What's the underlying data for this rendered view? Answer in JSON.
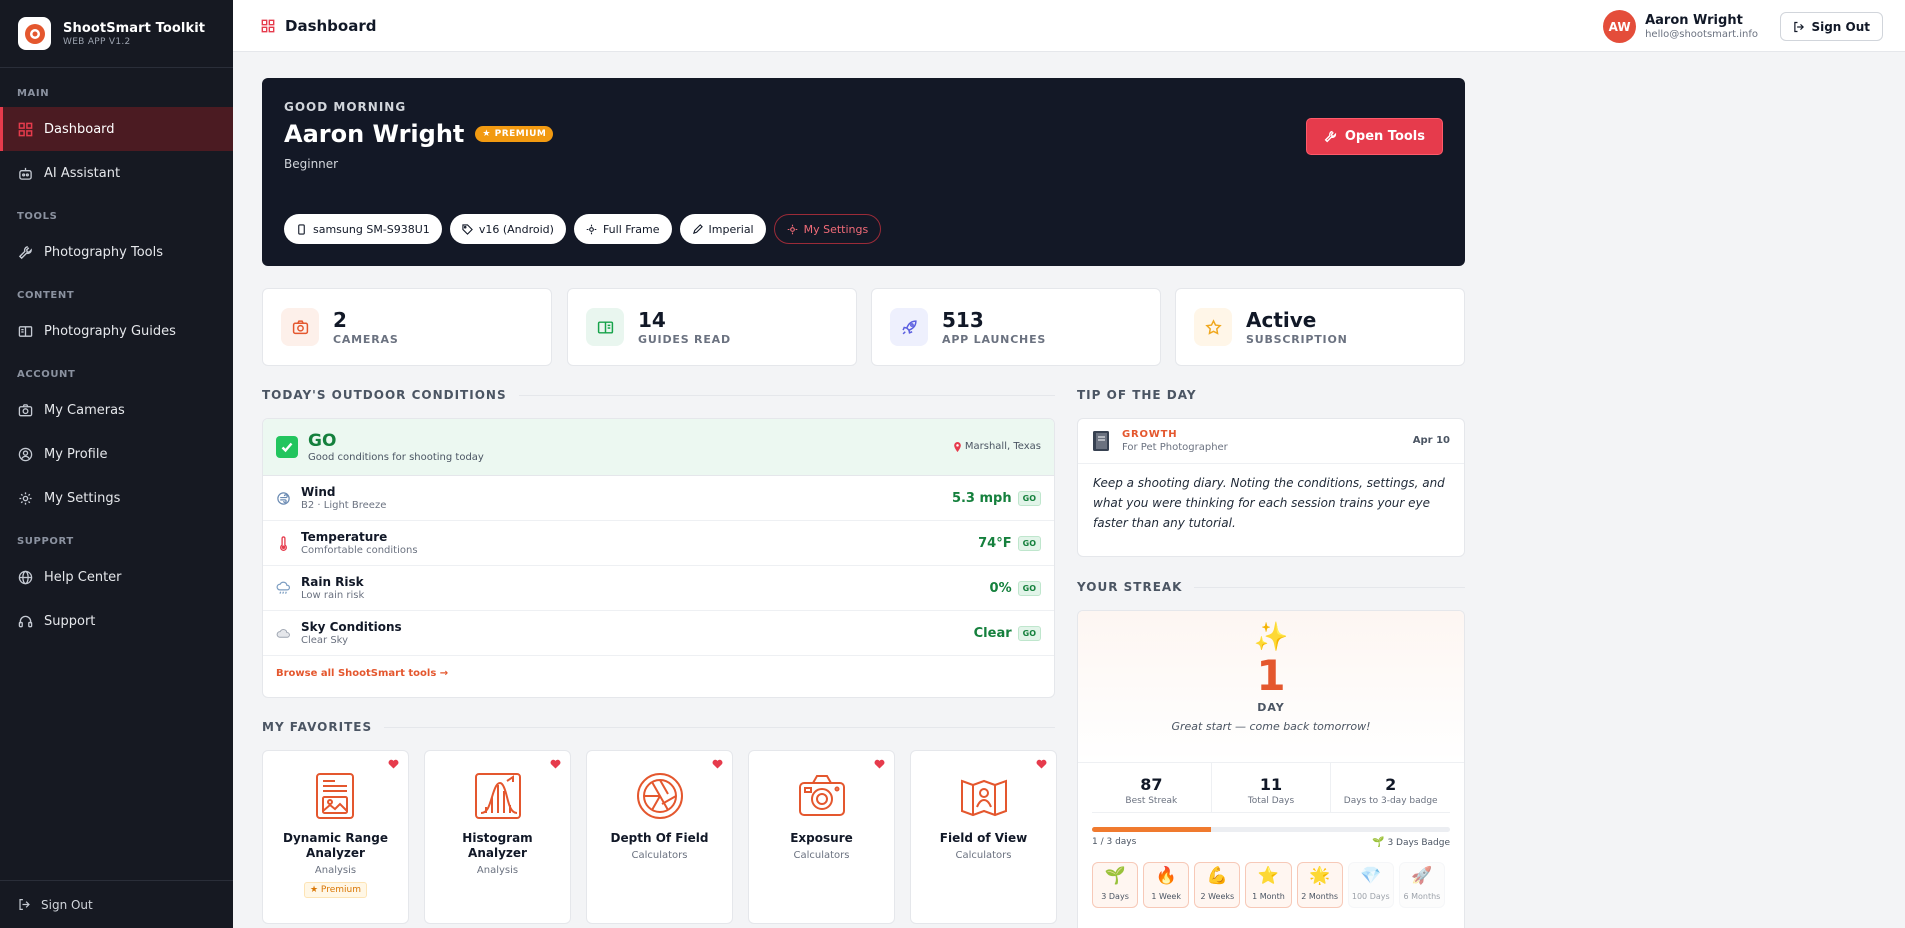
{
  "app": {
    "name": "ShootSmart Toolkit",
    "version": "WEB APP V1.2"
  },
  "sidebar": {
    "sections": {
      "main": "MAIN",
      "tools": "TOOLS",
      "content": "CONTENT",
      "account": "ACCOUNT",
      "support": "SUPPORT"
    },
    "items": [
      {
        "label": "Dashboard",
        "icon": "grid-icon"
      },
      {
        "label": "AI Assistant",
        "icon": "robot-icon"
      },
      {
        "label": "Photography Tools",
        "icon": "wrench-icon"
      },
      {
        "label": "Photography Guides",
        "icon": "book-icon"
      },
      {
        "label": "My Cameras",
        "icon": "camera-icon"
      },
      {
        "label": "My Profile",
        "icon": "user-icon"
      },
      {
        "label": "My Settings",
        "icon": "gear-icon"
      },
      {
        "label": "Help Center",
        "icon": "globe-icon"
      },
      {
        "label": "Support",
        "icon": "headset-icon"
      }
    ],
    "sign_out": "Sign Out"
  },
  "header": {
    "title": "Dashboard",
    "user": {
      "initials": "AW",
      "name": "Aaron Wright",
      "email": "hello@shootsmart.info"
    },
    "sign_out": "Sign Out"
  },
  "hero": {
    "greeting": "GOOD MORNING",
    "name": "Aaron Wright",
    "badge": "★ PREMIUM",
    "level": "Beginner",
    "open_tools": "Open Tools",
    "chips": [
      "samsung SM-S938U1",
      "v16 (Android)",
      "Full Frame",
      "Imperial",
      "My Settings"
    ]
  },
  "stats": [
    {
      "value": "2",
      "label": "CAMERAS",
      "icon": "camera-icon"
    },
    {
      "value": "14",
      "label": "GUIDES READ",
      "icon": "book-icon"
    },
    {
      "value": "513",
      "label": "APP LAUNCHES",
      "icon": "rocket-icon"
    },
    {
      "value": "Active",
      "label": "SUBSCRIPTION",
      "icon": "star-icon"
    }
  ],
  "conditions": {
    "heading": "TODAY'S OUTDOOR CONDITIONS",
    "status": "GO",
    "status_sub": "Good conditions for shooting today",
    "location": "Marshall, Texas",
    "rows": [
      {
        "name": "Wind",
        "desc": "B2 · Light Breeze",
        "value": "5.3 mph",
        "tag": "GO"
      },
      {
        "name": "Temperature",
        "desc": "Comfortable conditions",
        "value": "74°F",
        "tag": "GO"
      },
      {
        "name": "Rain Risk",
        "desc": "Low rain risk",
        "value": "0%",
        "tag": "GO"
      },
      {
        "name": "Sky Conditions",
        "desc": "Clear Sky",
        "value": "Clear",
        "tag": "GO"
      }
    ],
    "link": "Browse all ShootSmart tools →"
  },
  "favorites": {
    "heading": "MY FAVORITES",
    "items": [
      {
        "name": "Dynamic Range Analyzer",
        "category": "Analysis",
        "badge": "★ Premium"
      },
      {
        "name": "Histogram Analyzer",
        "category": "Analysis"
      },
      {
        "name": "Depth Of Field",
        "category": "Calculators"
      },
      {
        "name": "Exposure",
        "category": "Calculators"
      },
      {
        "name": "Field of View",
        "category": "Calculators"
      }
    ]
  },
  "tip": {
    "heading": "TIP OF THE DAY",
    "category": "GROWTH",
    "for": "For Pet Photographer",
    "date": "Apr 10",
    "body": "Keep a shooting diary. Noting the conditions, settings, and what you were thinking for each session trains your eye faster than any tutorial."
  },
  "streak": {
    "heading": "YOUR STREAK",
    "count": "1",
    "unit": "DAY",
    "message": "Great start — come back tomorrow!",
    "stats": [
      {
        "value": "87",
        "label": "Best Streak"
      },
      {
        "value": "11",
        "label": "Total Days"
      },
      {
        "value": "2",
        "label": "Days to 3-day badge"
      }
    ],
    "progress_text": "1 / 3 days",
    "progress_fraction": 0.333,
    "next_badge": "3 Days Badge",
    "badges": [
      {
        "label": "3 Days",
        "glyph": "🌱",
        "locked": false
      },
      {
        "label": "1 Week",
        "glyph": "🔥",
        "locked": false
      },
      {
        "label": "2 Weeks",
        "glyph": "💪",
        "locked": false
      },
      {
        "label": "1 Month",
        "glyph": "⭐",
        "locked": false
      },
      {
        "label": "2 Months",
        "glyph": "🌟",
        "locked": false
      },
      {
        "label": "100 Days",
        "glyph": "💎",
        "locked": true
      },
      {
        "label": "6 Months",
        "glyph": "🚀",
        "locked": true
      }
    ]
  }
}
